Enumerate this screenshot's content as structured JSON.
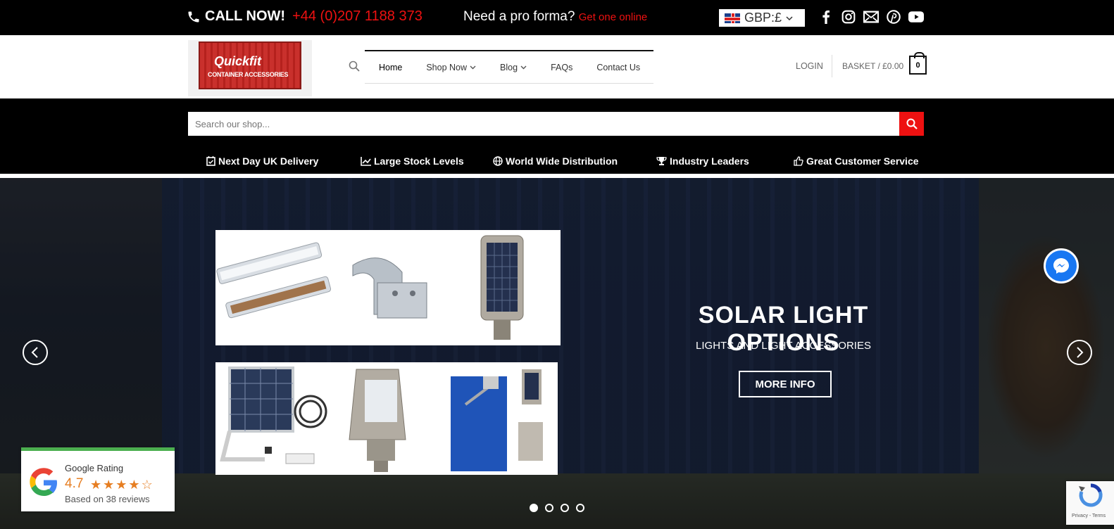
{
  "topbar": {
    "call_label": "CALL NOW!",
    "phone": "+44 (0)207 1188 373",
    "proforma_label": "Need a pro forma?",
    "proforma_link": "Get one online",
    "currency": "GBP:£"
  },
  "socials": [
    "facebook-icon",
    "instagram-icon",
    "email-icon",
    "pinterest-icon",
    "youtube-icon"
  ],
  "logo": {
    "line1": "Quickfit",
    "line2": "CONTAINER ACCESSORIES"
  },
  "nav": {
    "items": [
      "Home",
      "Shop Now",
      "Blog",
      "FAQs",
      "Contact Us"
    ]
  },
  "account": {
    "login": "LOGIN",
    "basket": "BASKET / £0.00",
    "basket_count": "0"
  },
  "search": {
    "placeholder": "Search our shop..."
  },
  "usps": [
    "Next Day UK Delivery",
    "Large Stock Levels",
    "World Wide Distribution",
    "Industry Leaders",
    "Great Customer Service"
  ],
  "hero": {
    "title": "SOLAR LIGHT OPTIONS",
    "subtitle": "LIGHTS AND LIGHT ACCESSORIES",
    "button": "MORE INFO",
    "slide_count": 4,
    "active_slide": 1
  },
  "rating": {
    "label": "Google Rating",
    "score": "4.7",
    "based_on": "Based on 38 reviews",
    "stars": 4.7
  },
  "recaptcha": {
    "text": "Privacy - Terms"
  },
  "colors": {
    "accent": "#e11111",
    "topbar": "#000000",
    "messenger": "#1877f2",
    "rating_green": "#4caf50",
    "star": "#e67e22"
  }
}
